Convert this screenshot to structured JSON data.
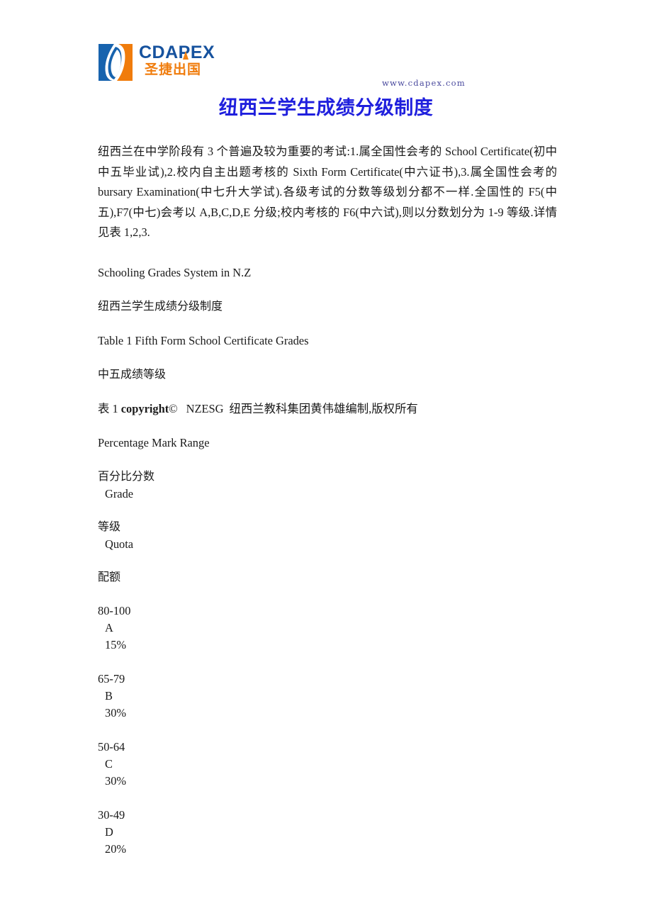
{
  "header": {
    "logo": {
      "mark_name": "cdapex-logo-mark",
      "wordmark": "CDAPEX",
      "wordmark_cn": "圣捷出国",
      "brand_blue": "#16529e",
      "brand_orange": "#f07c0c"
    },
    "site_url": "www.cdapex.com",
    "url_color": "#4a4a9e"
  },
  "title": {
    "text": "纽西兰学生成绩分级制度",
    "color": "#1f1fdd"
  },
  "intro": {
    "paragraph": "纽西兰在中学阶段有 3 个普遍及较为重要的考试:1.属全国性会考的 School Certificate(初中中五毕业试),2.校内自主出题考核的 Sixth Form Certificate(中六证书),3.属全国性会考的 bursary Examination(中七升大学试).各级考试的分数等级划分都不一样.全国性的 F5(中五),F7(中七)会考以 A,B,C,D,E 分级;校内考核的 F6(中六试),则以分数划分为 1-9 等级.详情见表 1,2,3."
  },
  "sections": {
    "system_heading_en": "Schooling Grades System in N.Z",
    "system_heading_cn": "纽西兰学生成绩分级制度",
    "table_caption_en": "Table 1 Fifth Form School Certificate Grades",
    "table_caption_cn": "中五成绩等级",
    "copyright": {
      "prefix": "表 1 ",
      "word": "copyright",
      "symbol": "©",
      "org": "NZESG",
      "detail": "纽西兰教科集团黄伟雄编制,版权所有"
    }
  },
  "table": {
    "headers": [
      {
        "en": "Percentage Mark Range",
        "cn": "百分比分数"
      },
      {
        "en": "Grade",
        "cn": "等级"
      },
      {
        "en": "Quota",
        "cn": "配额"
      }
    ],
    "rows": [
      {
        "range": "80-100",
        "grade": "A",
        "quota": "15%"
      },
      {
        "range": "65-79",
        "grade": "B",
        "quota": "30%"
      },
      {
        "range": "50-64",
        "grade": "C",
        "quota": "30%"
      },
      {
        "range": "30-49",
        "grade": "D",
        "quota": "20%"
      }
    ]
  }
}
